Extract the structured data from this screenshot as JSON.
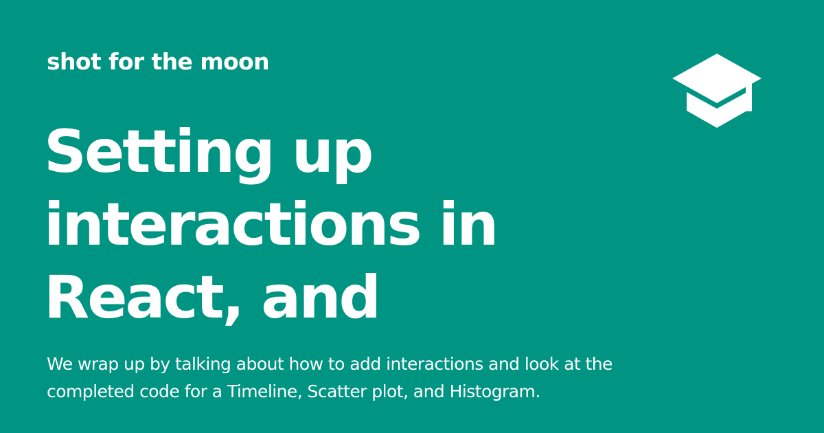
{
  "site": {
    "name": "shot for the moon",
    "logo_icon": "graduation-cap-icon"
  },
  "post": {
    "title_lines": [
      "Setting up",
      "interactions in",
      "React, and"
    ],
    "description": "We wrap up by talking about how to add interactions and look at the completed code for a Timeline, Scatter plot, and Histogram."
  },
  "colors": {
    "background": "#009483",
    "text": "#ffffff"
  }
}
